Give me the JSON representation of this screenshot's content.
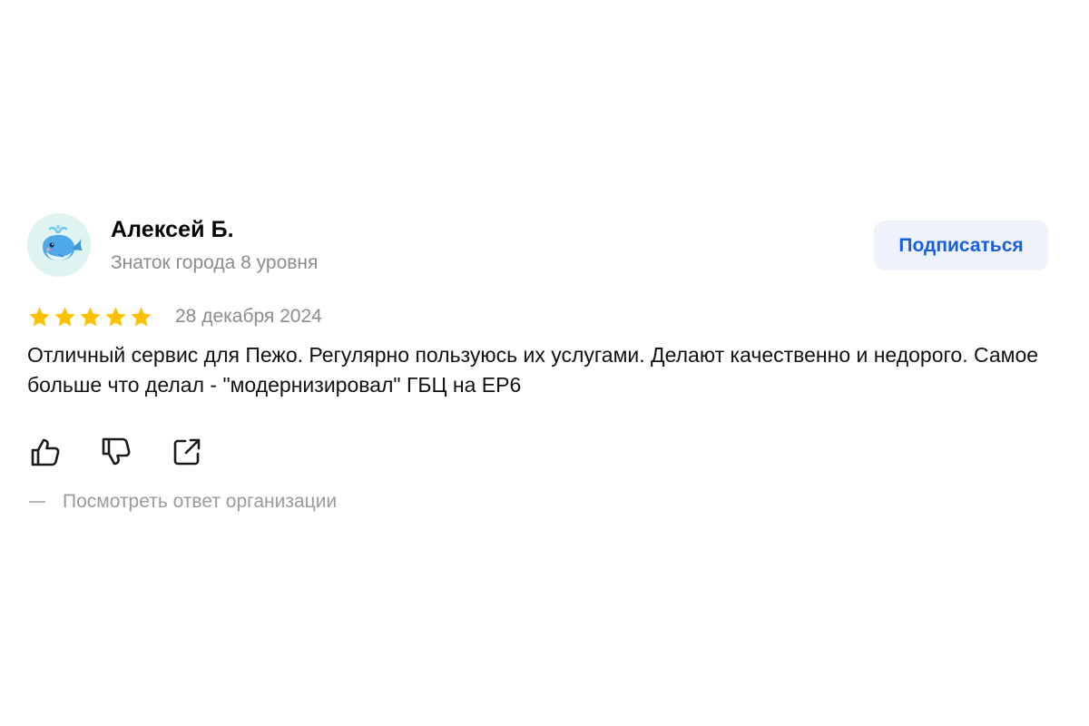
{
  "author": {
    "name": "Алексей Б.",
    "level": "Знаток города 8 уровня",
    "avatar_icon": "whale-icon"
  },
  "subscribe_label": "Подписаться",
  "rating": {
    "value": 5,
    "max": 5,
    "color": "#fcc100"
  },
  "date": "28 декабря 2024",
  "review_text": "Отличный сервис для Пежо. Регулярно пользуюсь их услугами. Делают качественно и недорого. Самое больше что делал - \"модернизировал\" ГБЦ на EP6",
  "actions": {
    "like_icon": "thumbs-up-icon",
    "dislike_icon": "thumbs-down-icon",
    "share_icon": "share-icon"
  },
  "view_response_label": "Посмотреть ответ организации",
  "colors": {
    "accent": "#1a5fe0",
    "button_bg": "#eef3fb",
    "muted_text": "#8c8c8c",
    "avatar_bg": "#dff3f1"
  }
}
